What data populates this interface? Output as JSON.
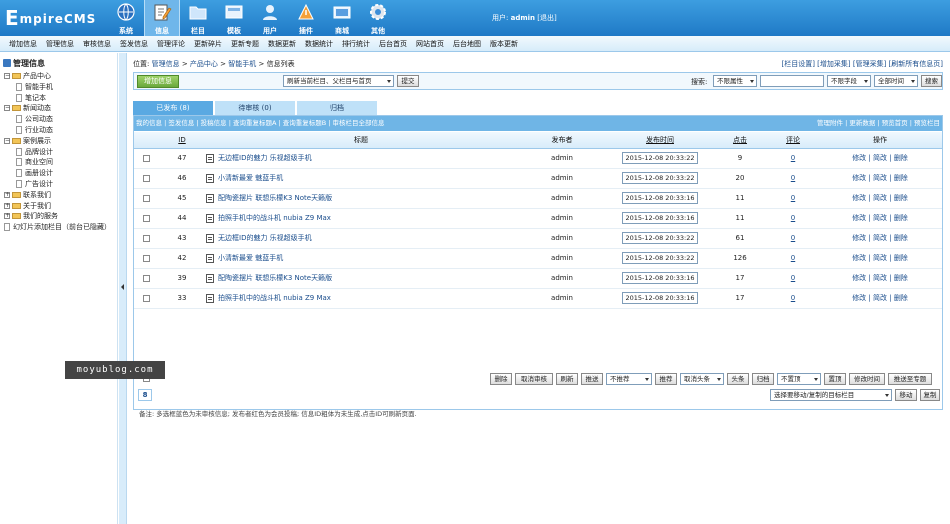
{
  "app": {
    "logo_text": "EmpireCMS"
  },
  "topnav": [
    {
      "label": "系统",
      "icon": "globe-icon"
    },
    {
      "label": "信息",
      "icon": "edit-icon"
    },
    {
      "label": "栏目",
      "icon": "folder-icon"
    },
    {
      "label": "模板",
      "icon": "template-icon"
    },
    {
      "label": "用户",
      "icon": "user-icon"
    },
    {
      "label": "插件",
      "icon": "plugin-icon"
    },
    {
      "label": "商城",
      "icon": "shop-icon"
    },
    {
      "label": "其他",
      "icon": "gear-icon"
    }
  ],
  "user": {
    "prefix": "用户:",
    "name": "admin",
    "logout": "[退出]"
  },
  "subnav": [
    "增加信息",
    "管理信息",
    "审核信息",
    "签发信息",
    "管理评论",
    "更新碎片",
    "更新专题",
    "数据更新",
    "数据统计",
    "排行统计",
    "后台首页",
    "网站首页",
    "后台地图",
    "版本更新"
  ],
  "sidebar": {
    "root": "管理信息",
    "items": [
      {
        "label": "产品中心",
        "level": 1,
        "type": "folder",
        "expanded": true
      },
      {
        "label": "智能手机",
        "level": 2,
        "type": "doc"
      },
      {
        "label": "笔记本",
        "level": 2,
        "type": "doc"
      },
      {
        "label": "新闻动态",
        "level": 1,
        "type": "folder",
        "expanded": true
      },
      {
        "label": "公司动态",
        "level": 2,
        "type": "doc"
      },
      {
        "label": "行业动态",
        "level": 2,
        "type": "doc"
      },
      {
        "label": "案例展示",
        "level": 1,
        "type": "folder",
        "expanded": true
      },
      {
        "label": "品牌设计",
        "level": 2,
        "type": "doc"
      },
      {
        "label": "商业空间",
        "level": 2,
        "type": "doc"
      },
      {
        "label": "画册设计",
        "level": 2,
        "type": "doc"
      },
      {
        "label": "广告设计",
        "level": 2,
        "type": "doc"
      },
      {
        "label": "联系我们",
        "level": 1,
        "type": "folder",
        "expanded": false
      },
      {
        "label": "关于我们",
        "level": 1,
        "type": "folder",
        "expanded": false
      },
      {
        "label": "我们的服务",
        "level": 1,
        "type": "folder",
        "expanded": false
      },
      {
        "label": "幻灯片添加栏目（前台已隐藏）",
        "level": 1,
        "type": "doc"
      }
    ]
  },
  "breadcrumb": {
    "prefix": "位置:",
    "items": [
      "管理信息",
      "产品中心",
      "智能手机",
      "信息列表"
    ]
  },
  "toplinks": "[栏目设置] [增加采集] [管理采集] [刷新所有信息页]",
  "toolbar": {
    "add_label": "增加信息",
    "refresh_select": "刷新当前栏目、父栏目与首页",
    "submit_label": "提交",
    "search_label": "搜索:",
    "attr_select": "不限属性",
    "search_value": "",
    "field_select": "不限字段",
    "time_select": "全部时间",
    "search_btn": "搜索"
  },
  "tabs": [
    {
      "label": "已发布 (8)",
      "active": true
    },
    {
      "label": "待审核 (0)",
      "active": false
    },
    {
      "label": "归档",
      "active": false
    }
  ],
  "filterbar": {
    "left": "我的信息 | 签发信息 | 投稿信息 | 查询重复标题A | 查询重复标题B | 审核栏目全部信息",
    "right": "管理附件 | 更新数据 | 预览首页 | 预览栏目"
  },
  "table": {
    "headers": {
      "id": "ID",
      "title": "标题",
      "publisher": "发布者",
      "time": "发布时间",
      "clicks": "点击",
      "comments": "评论",
      "ops": "操作"
    },
    "rows": [
      {
        "id": "47",
        "title": "无边框ID的魅力 乐视超级手机",
        "publisher": "admin",
        "time": "2015-12-08 20:33:22",
        "clicks": "9",
        "comments": "0"
      },
      {
        "id": "46",
        "title": "小清新最爱 魅蓝手机",
        "publisher": "admin",
        "time": "2015-12-08 20:33:22",
        "clicks": "20",
        "comments": "0"
      },
      {
        "id": "45",
        "title": "配陶瓷摆片 联想乐檬K3 Note天籁版",
        "publisher": "admin",
        "time": "2015-12-08 20:33:16",
        "clicks": "11",
        "comments": "0"
      },
      {
        "id": "44",
        "title": "拍照手机中的战斗机 nubia Z9 Max",
        "publisher": "admin",
        "time": "2015-12-08 20:33:16",
        "clicks": "11",
        "comments": "0"
      },
      {
        "id": "43",
        "title": "无边框ID的魅力 乐视超级手机",
        "publisher": "admin",
        "time": "2015-12-08 20:33:22",
        "clicks": "61",
        "comments": "0"
      },
      {
        "id": "42",
        "title": "小清新最爱 魅蓝手机",
        "publisher": "admin",
        "time": "2015-12-08 20:33:22",
        "clicks": "126",
        "comments": "0"
      },
      {
        "id": "39",
        "title": "配陶瓷摆片 联想乐檬K3 Note天籁版",
        "publisher": "admin",
        "time": "2015-12-08 20:33:16",
        "clicks": "17",
        "comments": "0"
      },
      {
        "id": "33",
        "title": "拍照手机中的战斗机 nubia Z9 Max",
        "publisher": "admin",
        "time": "2015-12-08 20:33:16",
        "clicks": "17",
        "comments": "0"
      }
    ],
    "ops": [
      "修改",
      "简改",
      "删除"
    ]
  },
  "actions": [
    "删除",
    "取消审核",
    "刷新",
    "推送",
    "不推荐",
    "推荐",
    "取消头条",
    "头条",
    "归档",
    "不置顶",
    "置顶",
    "修改时间",
    "推送至专题"
  ],
  "pager": {
    "count": "8",
    "move_select": "选择要移动/复制的目标栏目",
    "move_btn": "移动",
    "copy_btn": "复制"
  },
  "note": "备注: 多选框蓝色为未审核信息; 发布者红色为会员投稿; 信息ID粗体为未生成,点击ID可刷新页面.",
  "watermark": "moyublog.com"
}
